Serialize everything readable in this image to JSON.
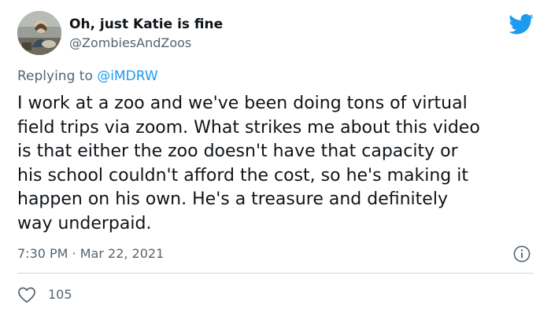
{
  "user": {
    "display_name": "Oh, just Katie is fine",
    "handle": "@ZombiesAndZoos",
    "avatar_icon": "profile-photo"
  },
  "brand": {
    "icon": "twitter-bird-icon",
    "color": "#1d9bf0"
  },
  "reply": {
    "prefix": "Replying to",
    "handle": "@iMDRW"
  },
  "tweet": {
    "lines": [
      "I work at a zoo and we've been doing tons of virtual",
      "field trips via zoom. What strikes me about this video",
      "is that either the zoo doesn't have that capacity or",
      "his school couldn't afford the cost, so he's making it",
      "happen on his own. He's a treasure and definitely",
      "way underpaid."
    ],
    "time": "7:30 PM",
    "separator": "·",
    "date": "Mar 22, 2021"
  },
  "actions": {
    "like_icon": "heart-icon",
    "like_count": "105",
    "info_icon": "info-icon"
  }
}
